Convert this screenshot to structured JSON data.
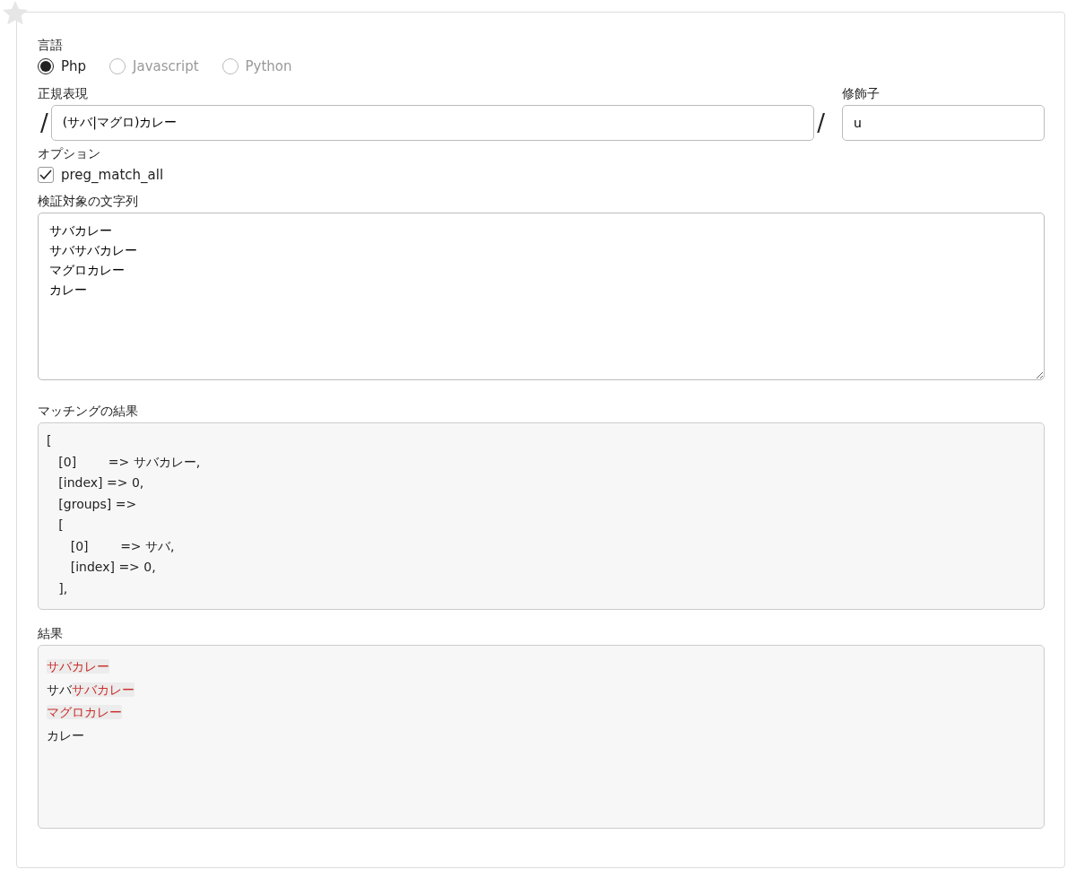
{
  "language": {
    "label": "言語",
    "options": [
      {
        "label": "Php",
        "selected": true
      },
      {
        "label": "Javascript",
        "selected": false
      },
      {
        "label": "Python",
        "selected": false
      }
    ]
  },
  "pattern": {
    "label": "正規表現",
    "delimiter_open": "/",
    "value": "(サバ|マグロ)カレー",
    "delimiter_close": "/"
  },
  "modifier": {
    "label": "修飾子",
    "value": "u"
  },
  "options": {
    "label": "オプション",
    "items": [
      {
        "label": "preg_match_all",
        "checked": true
      }
    ]
  },
  "subject": {
    "label": "検証対象の文字列",
    "lines": [
      "サバカレー",
      "サバサバカレー",
      "マグロカレー",
      "カレー"
    ]
  },
  "matching_result": {
    "label": "マッチングの結果",
    "lines": [
      "[",
      "   [0]        => サバカレー,",
      "   [index] => 0,",
      "   [groups] =>",
      "   [",
      "      [0]        => サバ,",
      "      [index] => 0,",
      "   ],"
    ]
  },
  "result": {
    "label": "結果",
    "lines": [
      {
        "segments": [
          {
            "text": "サバカレー",
            "matched": true
          }
        ]
      },
      {
        "segments": [
          {
            "text": "サバ",
            "matched": false
          },
          {
            "text": "サバカレー",
            "matched": true
          }
        ]
      },
      {
        "segments": [
          {
            "text": "マグロカレー",
            "matched": true
          }
        ]
      },
      {
        "segments": [
          {
            "text": "カレー",
            "matched": false
          }
        ]
      }
    ]
  }
}
